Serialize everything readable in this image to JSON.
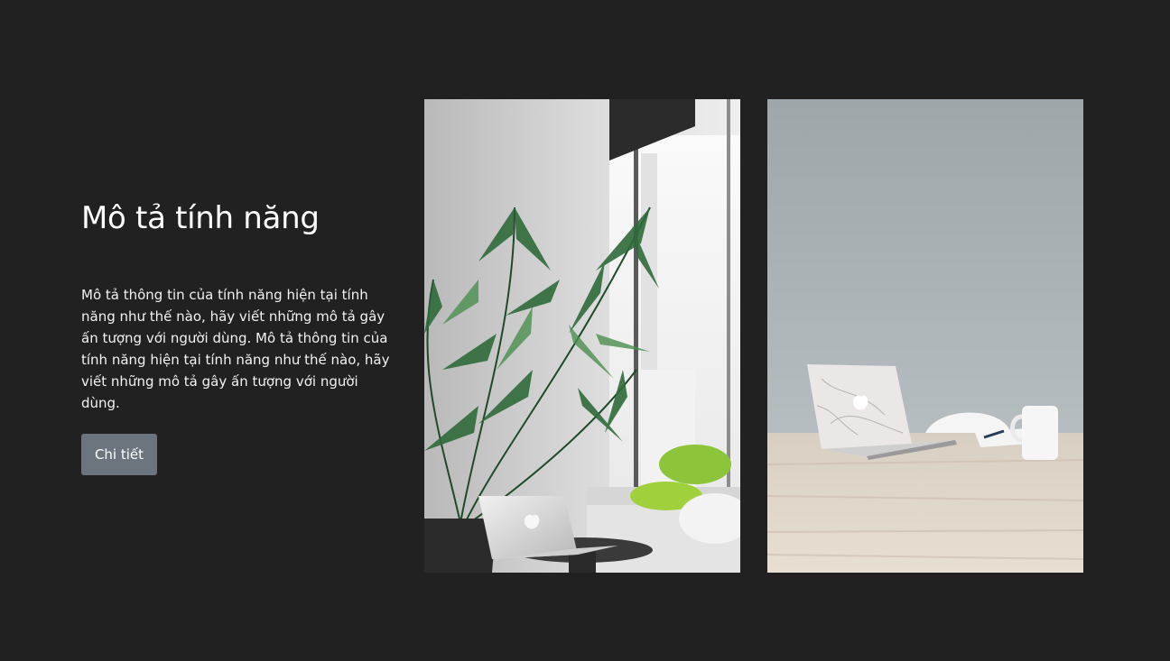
{
  "feature": {
    "title": "Mô tả tính năng",
    "description": "Mô tả thông tin của tính năng hiện tại tính năng như thế nào, hãy viết những mô tả gây ấn tượng với người dùng. Mô tả thông tin của tính năng hiện tại tính năng như thế nào, hãy viết những mô tả gây ấn tượng với người dùng.",
    "button_label": "Chi tiết"
  },
  "colors": {
    "background": "#222122",
    "button": "#6c757d",
    "text": "#ffffff"
  },
  "images": [
    {
      "name": "plant-window-laptop-photo"
    },
    {
      "name": "marble-laptop-desk-photo"
    }
  ]
}
